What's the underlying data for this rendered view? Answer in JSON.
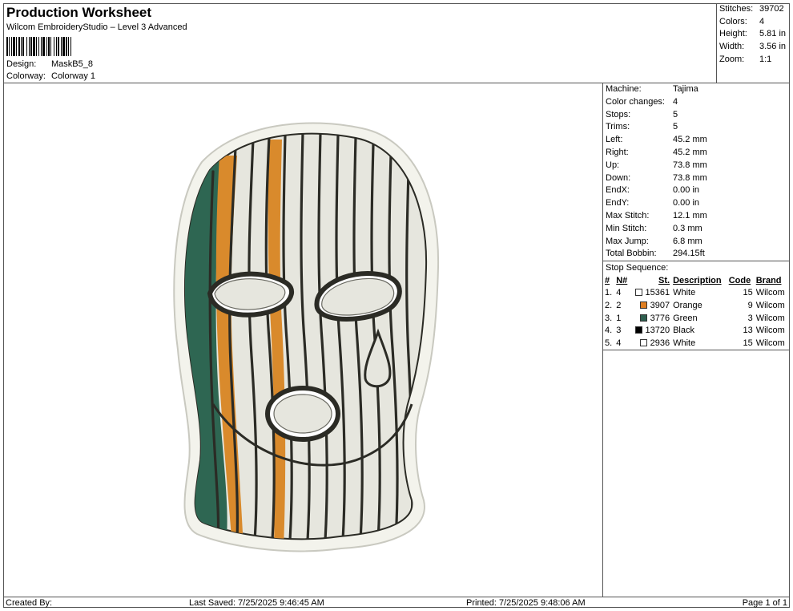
{
  "header": {
    "title": "Production Worksheet",
    "subtitle": "Wilcom EmbroideryStudio – Level 3 Advanced",
    "design_label": "Design:",
    "design_value": "MaskB5_8",
    "colorway_label": "Colorway:",
    "colorway_value": "Colorway 1"
  },
  "stats": [
    {
      "label": "Stitches:",
      "value": "39702"
    },
    {
      "label": "Colors:",
      "value": "4"
    },
    {
      "label": "Height:",
      "value": "5.81 in"
    },
    {
      "label": "Width:",
      "value": "3.56 in"
    },
    {
      "label": "Zoom:",
      "value": "1:1"
    }
  ],
  "machine": [
    {
      "label": "Machine:",
      "value": "Tajima"
    },
    {
      "label": "Color changes:",
      "value": "4"
    },
    {
      "label": "Stops:",
      "value": "5"
    },
    {
      "label": "Trims:",
      "value": "5"
    },
    {
      "label": "Left:",
      "value": "45.2 mm"
    },
    {
      "label": "Right:",
      "value": "45.2 mm"
    },
    {
      "label": "Up:",
      "value": "73.8 mm"
    },
    {
      "label": "Down:",
      "value": "73.8 mm"
    },
    {
      "label": "EndX:",
      "value": "0.00 in"
    },
    {
      "label": "EndY:",
      "value": "0.00 in"
    },
    {
      "label": "Max Stitch:",
      "value": "12.1 mm"
    },
    {
      "label": "Min Stitch:",
      "value": "0.3 mm"
    },
    {
      "label": "Max Jump:",
      "value": "6.8 mm"
    },
    {
      "label": "Total Bobbin:",
      "value": "294.15ft"
    }
  ],
  "stop_sequence": {
    "title": "Stop Sequence:",
    "headers": [
      "#",
      "N#",
      "St.",
      "Description",
      "Code",
      "Brand"
    ],
    "rows": [
      {
        "idx": "1.",
        "n": "4",
        "color": "#ffffff",
        "st": "15361",
        "desc": "White",
        "code": "15",
        "brand": "Wilcom"
      },
      {
        "idx": "2.",
        "n": "2",
        "color": "#e07f22",
        "st": "3907",
        "desc": "Orange",
        "code": "9",
        "brand": "Wilcom"
      },
      {
        "idx": "3.",
        "n": "1",
        "color": "#2e5e4e",
        "st": "3776",
        "desc": "Green",
        "code": "3",
        "brand": "Wilcom"
      },
      {
        "idx": "4.",
        "n": "3",
        "color": "#000000",
        "st": "13720",
        "desc": "Black",
        "code": "13",
        "brand": "Wilcom"
      },
      {
        "idx": "5.",
        "n": "4",
        "color": "#ffffff",
        "st": "2936",
        "desc": "White",
        "code": "15",
        "brand": "Wilcom"
      }
    ]
  },
  "footer": {
    "created_by": "Created By:",
    "last_saved": "Last Saved: 7/25/2025 9:46:45 AM",
    "printed": "Printed: 7/25/2025 9:48:06 AM",
    "page": "Page 1 of 1"
  },
  "colors": {
    "white_fill": "#e8e8e0",
    "green": "#2e6652",
    "orange": "#d98a2c",
    "black": "#2b2b25",
    "border": "#f0f0ea"
  }
}
